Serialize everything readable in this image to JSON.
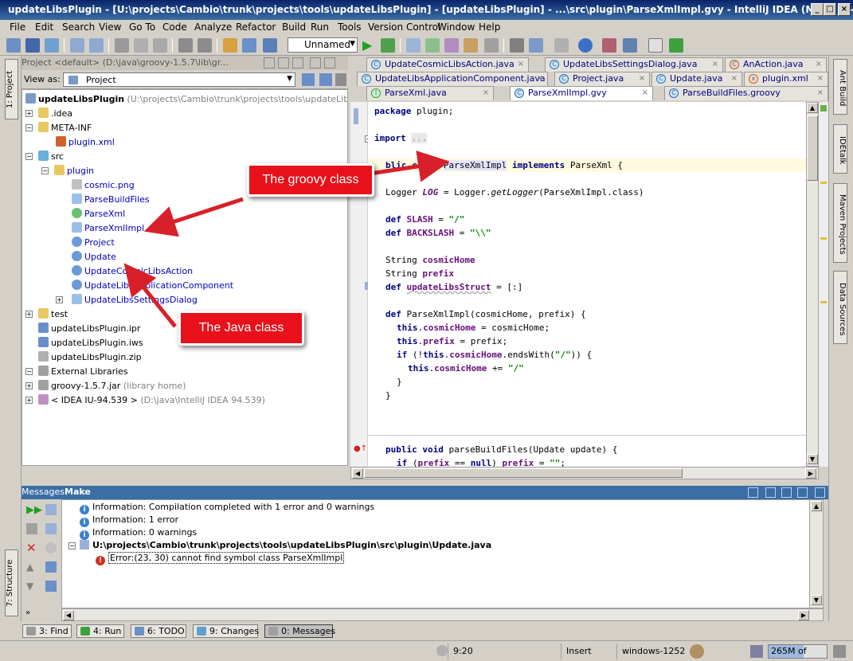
{
  "window": {
    "title": "updateLibsPlugin - [U:\\projects\\Cambio\\trunk\\projects\\tools\\updateLibsPlugin] - [updateLibsPlugin] - ...\\src\\plugin\\ParseXmlImpl.gvy - IntelliJ IDEA (Maia) IU-94.539"
  },
  "menu": [
    "File",
    "Edit",
    "Search",
    "View",
    "Go To",
    "Code",
    "Analyze",
    "Refactor",
    "Build",
    "Run",
    "Tools",
    "Version Control",
    "Window",
    "Help"
  ],
  "toolbar": {
    "run_config": "Unnamed"
  },
  "left_stripe": {
    "project_tab": "1: Project",
    "structure_tab": "7: Structure"
  },
  "project_panel": {
    "header": "Project  <default> (D:\\java\\groovy-1.5.7\\lib\\gr...",
    "view_as_label": "View as:",
    "view_as_value": "Project",
    "tree": [
      {
        "label": "updateLibsPlugin",
        "suffix": " (U:\\projects\\Cambio\\trunk\\projects\\tools\\updateLibsPlugin)"
      },
      {
        "label": ".idea"
      },
      {
        "label": "META-INF"
      },
      {
        "label": "plugin.xml"
      },
      {
        "label": "src"
      },
      {
        "label": "plugin"
      },
      {
        "label": "cosmic.png"
      },
      {
        "label": "ParseBuildFiles"
      },
      {
        "label": "ParseXml"
      },
      {
        "label": "ParseXmlImpl"
      },
      {
        "label": "Project"
      },
      {
        "label": "Update"
      },
      {
        "label": "UpdateCosmicLibsAction"
      },
      {
        "label": "UpdateLibsApplicationComponent"
      },
      {
        "label": "UpdateLibsSettingsDialog"
      },
      {
        "label": "test"
      },
      {
        "label": "updateLibsPlugin.ipr"
      },
      {
        "label": "updateLibsPlugin.iws"
      },
      {
        "label": "updateLibsPlugin.zip"
      },
      {
        "label": "External Libraries"
      },
      {
        "label": "groovy-1.5.7.jar",
        "suffix": " (library home)"
      },
      {
        "label": "< IDEA IU-94.539 >",
        "suffix": " (D:\\java\\IntelliJ IDEA 94.539)"
      }
    ]
  },
  "editor": {
    "tabs_row1": [
      "UpdateCosmicLibsAction.java",
      "UpdateLibsSettingsDialog.java",
      "AnAction.java"
    ],
    "tabs_row2": [
      "UpdateLibsApplicationComponent.java",
      "Project.java",
      "Update.java",
      "plugin.xml"
    ],
    "tabs_row3": [
      "ParseXml.java",
      "ParseXmlImpl.gvy",
      "ParseBuildFiles.groovy"
    ],
    "code": {
      "l1": "plugin;",
      "l2": "...",
      "l3a": "ParseXmlImpl",
      "l3b": "ParseXml {",
      "l4a": "Logger ",
      "l4b": "LOG",
      " l4c": " = Logger.",
      "l4d": "getLogger",
      "l4e": "(ParseXmlImpl.class)",
      "slash": "SLASH",
      "slashv": "\"/\"",
      "bslash": "BACKSLASH",
      "bslashv": "\"\\\\\"",
      "ch": "cosmicHome",
      "pf": "prefix",
      "uls": "updateLibsStruct"
    }
  },
  "right_stripe": [
    "Ant Build",
    "IDEtalk",
    "Maven Projects",
    "Data Sources"
  ],
  "messages": {
    "header_left": "Messages",
    "header_tab": "Make",
    "rows": [
      "Information: Compilation completed with 1 error and 0 warnings",
      "Information: 1 error",
      "Information: 0 warnings",
      "U:\\projects\\Cambio\\trunk\\projects\\tools\\updateLibsPlugin\\src\\plugin\\Update.java",
      "Error:(23, 30)  cannot find symbol class ParseXmlImpl"
    ]
  },
  "bottom_tabs": [
    "3: Find",
    "4: Run",
    "6: TODO",
    "9: Changes",
    "0: Messages"
  ],
  "status": {
    "position": "9:20",
    "mode": "Insert",
    "encoding": "windows-1252",
    "memory": "265M of 439M",
    "memory_fraction": 0.6
  },
  "callouts": {
    "groovy": "The groovy class",
    "java": "The Java class"
  },
  "colors": {
    "callout": "#e8101a",
    "accent": "#3a6ea5"
  }
}
